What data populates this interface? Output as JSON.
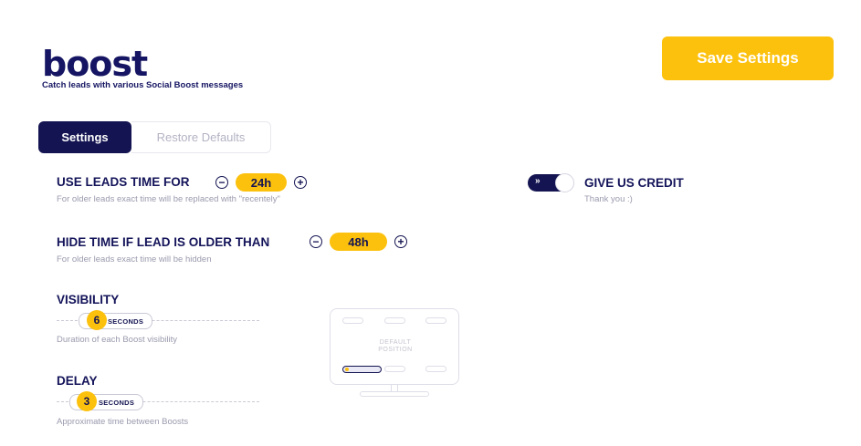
{
  "brand": {
    "name": "boost",
    "tagline": "Catch leads with various Social Boost messages"
  },
  "header": {
    "save_label": "Save Settings"
  },
  "tabs": [
    {
      "label": "Settings",
      "active": true
    },
    {
      "label": "Restore Defaults",
      "active": false
    }
  ],
  "settings": {
    "leads_time": {
      "title": "USE LEADS TIME FOR",
      "value": "24h",
      "help": "For older leads exact time will be replaced with \"recentely\""
    },
    "hide_time": {
      "title": "HIDE TIME IF LEAD IS OLDER THAN",
      "value": "48h",
      "help": "For older leads exact time will be hidden"
    },
    "visibility": {
      "title": "VISIBILITY",
      "value": "6",
      "unit": "SECONDS",
      "help": "Duration of each Boost visibility"
    },
    "delay": {
      "title": "DELAY",
      "value": "3",
      "unit": "SECONDS",
      "help": "Approximate time between Boosts"
    },
    "credit": {
      "title": "GIVE US CREDIT",
      "help": "Thank you :)",
      "enabled": true
    }
  },
  "position_preview": {
    "label_line1": "DEFAULT",
    "label_line2": "POSITION"
  },
  "icons": {
    "minus": "minus-icon",
    "plus": "plus-icon",
    "toggle_arrow": "arrows-icon"
  },
  "colors": {
    "accent": "#fcc10d",
    "navy": "#141452",
    "muted": "#9a9aae",
    "border": "#dedee8"
  }
}
